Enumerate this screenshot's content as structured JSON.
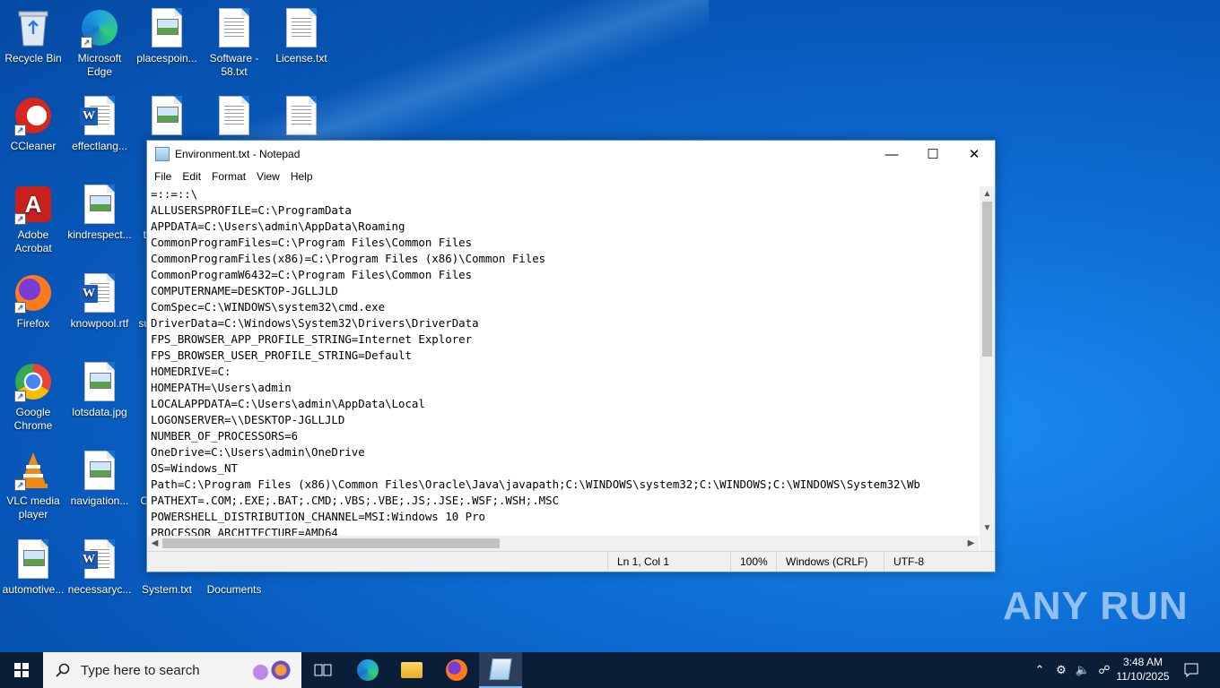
{
  "desktop": {
    "icons": [
      {
        "label": "Recycle Bin"
      },
      {
        "label": "Microsoft Edge"
      },
      {
        "label": "placespoin..."
      },
      {
        "label": "Software - 58.txt"
      },
      {
        "label": "License.txt"
      },
      {
        "label": "CCleaner"
      },
      {
        "label": "effectlang..."
      },
      {
        "label": "sp"
      },
      {
        "label": "Adobe Acrobat"
      },
      {
        "label": "kindrespect..."
      },
      {
        "label": "t"
      },
      {
        "label": "Firefox"
      },
      {
        "label": "knowpool.rtf"
      },
      {
        "label": "su"
      },
      {
        "label": "Google Chrome"
      },
      {
        "label": "lotsdata.jpg"
      },
      {
        "label": "VLC media player"
      },
      {
        "label": "navigation..."
      },
      {
        "label": "C"
      },
      {
        "label": "automotive..."
      },
      {
        "label": "necessaryc..."
      },
      {
        "label": "System.txt"
      },
      {
        "label": "Documents"
      }
    ]
  },
  "notepad": {
    "title": "Environment.txt - Notepad",
    "menu": [
      "File",
      "Edit",
      "Format",
      "View",
      "Help"
    ],
    "lines": [
      "=::=::\\",
      "ALLUSERSPROFILE=C:\\ProgramData",
      "APPDATA=C:\\Users\\admin\\AppData\\Roaming",
      "CommonProgramFiles=C:\\Program Files\\Common Files",
      "CommonProgramFiles(x86)=C:\\Program Files (x86)\\Common Files",
      "CommonProgramW6432=C:\\Program Files\\Common Files",
      "COMPUTERNAME=DESKTOP-JGLLJLD",
      "ComSpec=C:\\WINDOWS\\system32\\cmd.exe",
      "DriverData=C:\\Windows\\System32\\Drivers\\DriverData",
      "FPS_BROWSER_APP_PROFILE_STRING=Internet Explorer",
      "FPS_BROWSER_USER_PROFILE_STRING=Default",
      "HOMEDRIVE=C:",
      "HOMEPATH=\\Users\\admin",
      "LOCALAPPDATA=C:\\Users\\admin\\AppData\\Local",
      "LOGONSERVER=\\\\DESKTOP-JGLLJLD",
      "NUMBER_OF_PROCESSORS=6",
      "OneDrive=C:\\Users\\admin\\OneDrive",
      "OS=Windows_NT",
      "Path=C:\\Program Files (x86)\\Common Files\\Oracle\\Java\\javapath;C:\\WINDOWS\\system32;C:\\WINDOWS;C:\\WINDOWS\\System32\\Wb",
      "PATHEXT=.COM;.EXE;.BAT;.CMD;.VBS;.VBE;.JS;.JSE;.WSF;.WSH;.MSC",
      "POWERSHELL_DISTRIBUTION_CHANNEL=MSI:Windows 10 Pro",
      "PROCESSOR_ARCHITECTURE=AMD64"
    ],
    "status": {
      "position": "Ln 1, Col 1",
      "zoom": "100%",
      "line_endings": "Windows (CRLF)",
      "encoding": "UTF-8"
    }
  },
  "taskbar": {
    "search_placeholder": "Type here to search",
    "time": "3:48 AM",
    "date": "11/10/2025"
  },
  "watermark": "ANY RUN"
}
